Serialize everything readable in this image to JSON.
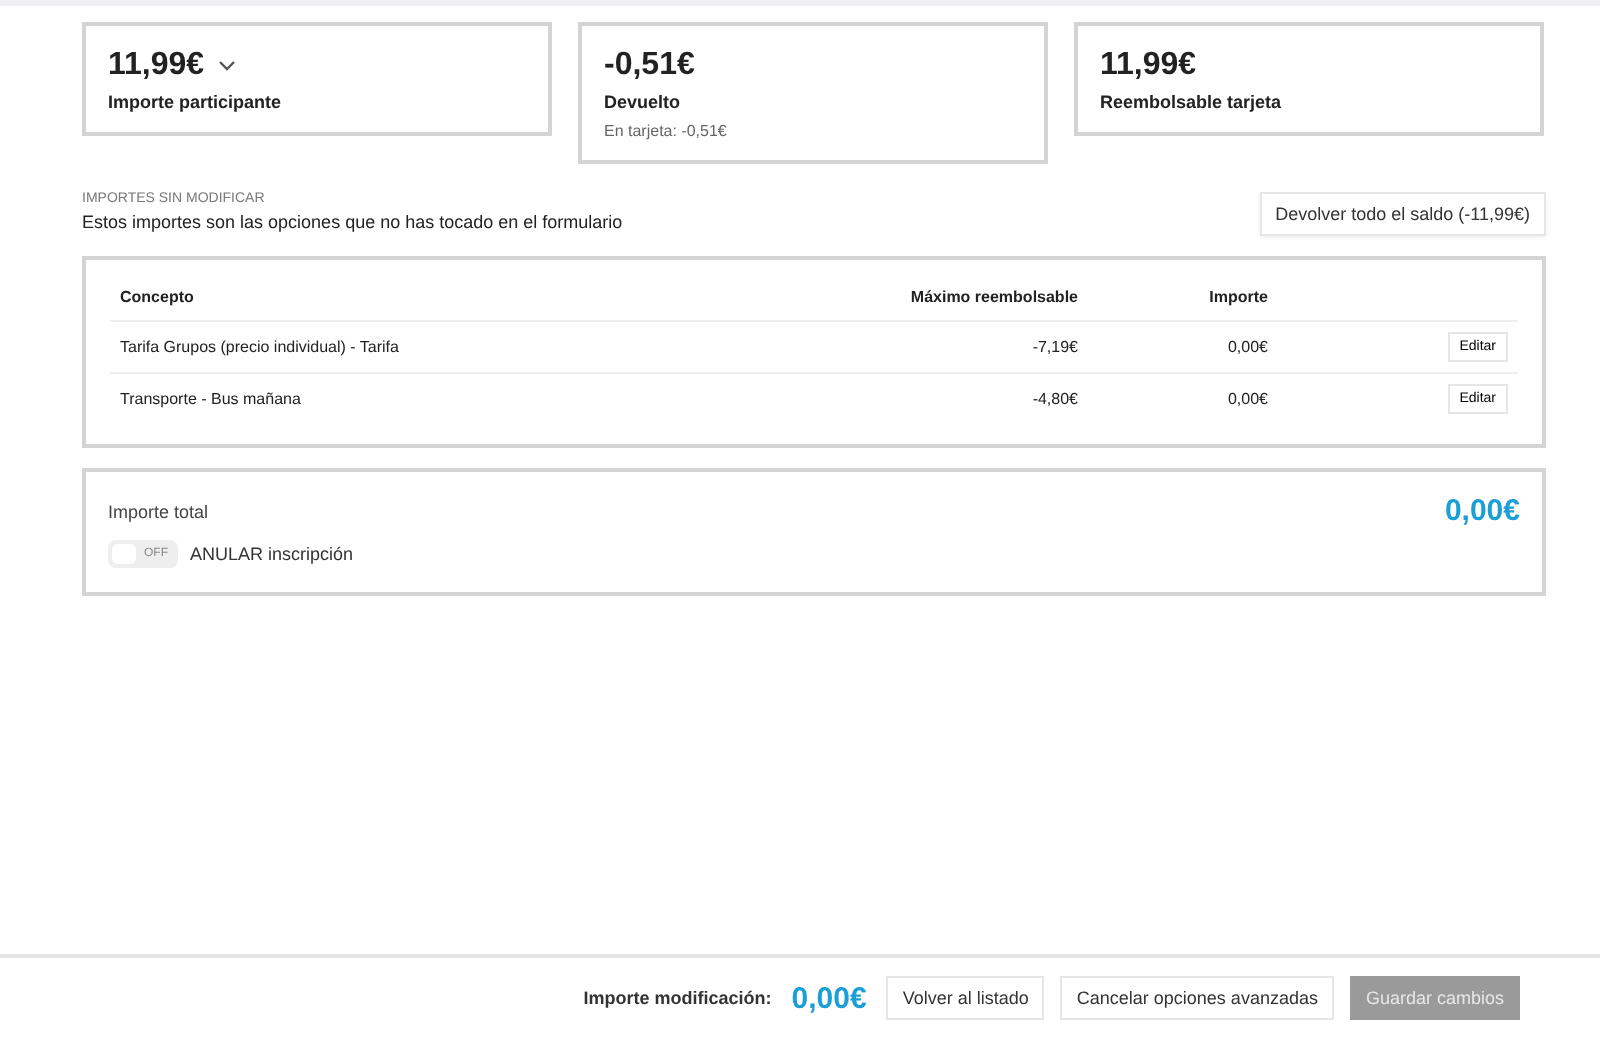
{
  "summary_cards": [
    {
      "amount": "11,99€",
      "label": "Importe participante",
      "dropdown": true
    },
    {
      "amount": "-0,51€",
      "label": "Devuelto",
      "note": "En tarjeta: -0,51€",
      "dropdown": false
    },
    {
      "amount": "11,99€",
      "label": "Reembolsable tarjeta",
      "dropdown": false
    }
  ],
  "section": {
    "heading": "IMPORTES SIN MODIFICAR",
    "description": "Estos importes son las opciones que no has tocado en el formulario",
    "action": "Devolver todo el saldo (-11,99€)"
  },
  "table": {
    "columns": [
      "Concepto",
      "Máximo reembolsable",
      "Importe"
    ],
    "rows": [
      {
        "concept": "Tarifa Grupos (precio individual) - Tarifa",
        "max": "-7,19€",
        "amount": "0,00€",
        "action": "Editar"
      },
      {
        "concept": "Transporte - Bus mañana",
        "max": "-4,80€",
        "amount": "0,00€",
        "action": "Editar"
      }
    ]
  },
  "total": {
    "label": "Importe total",
    "amount": "0,00€",
    "toggle": {
      "on": false,
      "state_text": "OFF",
      "label": "ANULAR inscripción"
    }
  },
  "footer": {
    "label": "Importe modificación:",
    "amount": "0,00€",
    "buttons": [
      {
        "label": "Volver al listado",
        "kind": "secondary",
        "disabled": false
      },
      {
        "label": "Cancelar opciones avanzadas",
        "kind": "secondary",
        "disabled": false
      },
      {
        "label": "Guardar cambios",
        "kind": "primary",
        "disabled": true
      }
    ]
  }
}
